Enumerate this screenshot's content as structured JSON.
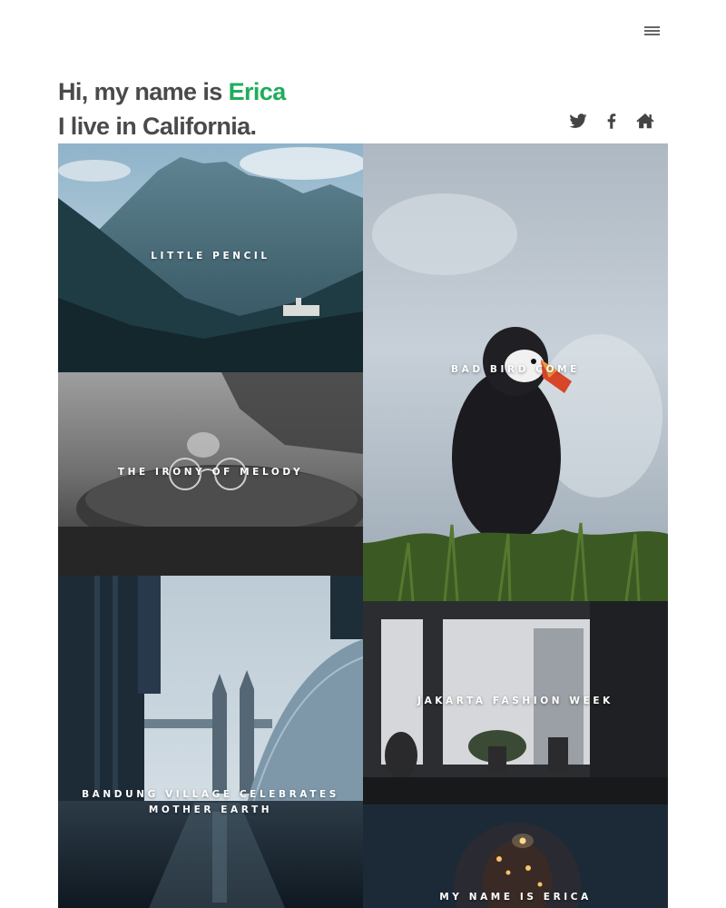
{
  "header": {
    "menu_icon": "hamburger-menu-icon",
    "intro_prefix": "Hi, my name is ",
    "intro_name": "Erica",
    "intro_line2": "I live in California.",
    "accent_color": "#1fad5b",
    "social_icons": [
      "twitter-icon",
      "facebook-icon",
      "home-icon"
    ]
  },
  "gallery": {
    "items": [
      {
        "title": "LITTLE PENCIL",
        "image": "mountain-landscape"
      },
      {
        "title": "BAD BIRD COME",
        "image": "puffin-on-grass"
      },
      {
        "title": "THE IRONY OF MELODY",
        "image": "glasses-on-hat-bw"
      },
      {
        "title": "BANDUNG VILLAGE CELEBRATES MOTHER EARTH",
        "image": "tower-bridge-city"
      },
      {
        "title": "JAKARTA FASHION WEEK",
        "image": "window-silhouette"
      },
      {
        "title": "MY NAME IS ERICA",
        "image": "woman-with-lights"
      }
    ]
  }
}
